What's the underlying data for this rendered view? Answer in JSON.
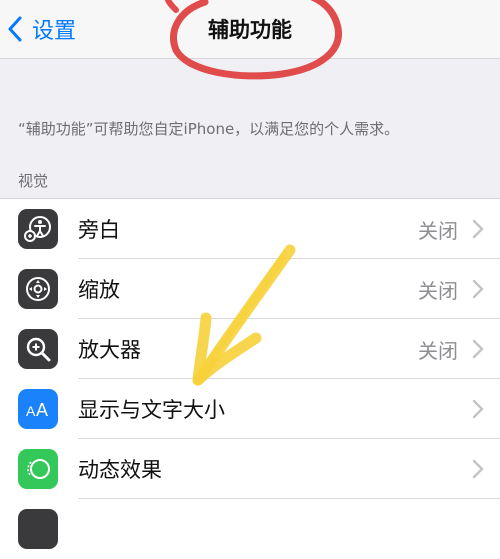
{
  "nav": {
    "back_label": "设置",
    "title": "辅助功能"
  },
  "description": "“辅助功能”可帮助您自定iPhone，以满足您的个人需求。",
  "section": {
    "header": "视觉"
  },
  "rows": [
    {
      "label": "旁白",
      "value": "关闭",
      "icon": "voiceover-icon",
      "icon_bg": "#3a3a3c"
    },
    {
      "label": "缩放",
      "value": "关闭",
      "icon": "zoom-icon",
      "icon_bg": "#3a3a3c"
    },
    {
      "label": "放大器",
      "value": "关闭",
      "icon": "magnifier-icon",
      "icon_bg": "#3a3a3c"
    },
    {
      "label": "显示与文字大小",
      "value": "",
      "icon": "text-size-icon",
      "icon_bg": "#1a82fb"
    },
    {
      "label": "动态效果",
      "value": "",
      "icon": "motion-icon",
      "icon_bg": "#34c759"
    },
    {
      "label": "",
      "value": "",
      "icon": "partial-row-icon",
      "icon_bg": "#3a3a3c"
    }
  ],
  "colors": {
    "accent": "#007aff",
    "annotation_circle": "#e04b4b",
    "annotation_arrow": "#f6d23a"
  }
}
